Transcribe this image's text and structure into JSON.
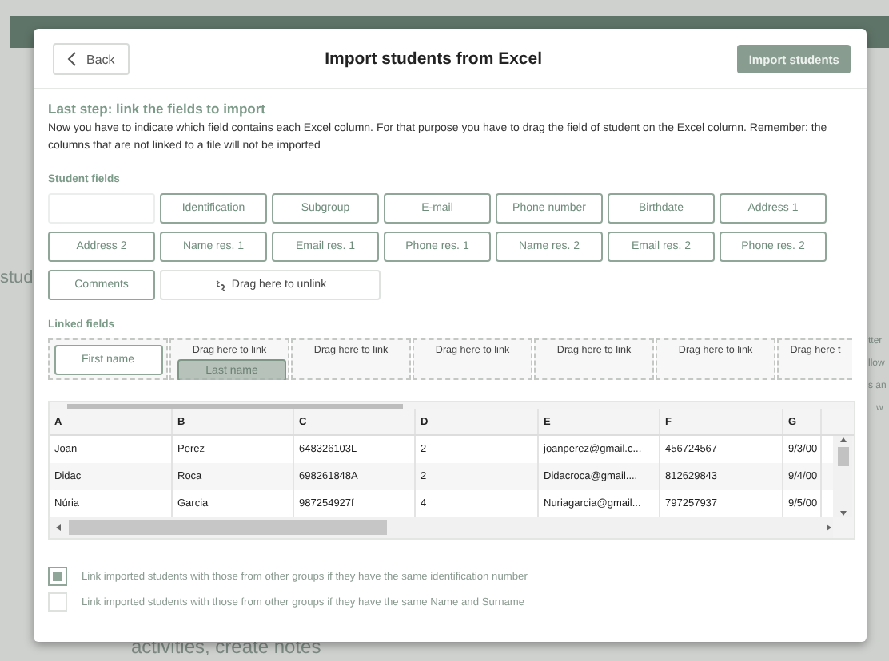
{
  "background": {
    "texts": [
      "stud",
      "tter",
      "llow",
      "s an",
      "w",
      "activities, create notes"
    ]
  },
  "dialog": {
    "back_label": "Back",
    "title": "Import students from Excel",
    "import_label": "Import students"
  },
  "step_title": "Last step: link the fields to import",
  "description": "Now you have to indicate which field contains each Excel column. For that purpose you have to drag the field of student on the Excel column. Remember: the columns that are not linked to a file will not be imported",
  "student_fields": {
    "title": "Student fields",
    "items": [
      {
        "kind": "empty"
      },
      {
        "kind": "chip",
        "label": "Identification"
      },
      {
        "kind": "chip",
        "label": "Subgroup"
      },
      {
        "kind": "chip",
        "label": "E-mail"
      },
      {
        "kind": "chip",
        "label": "Phone number"
      },
      {
        "kind": "chip",
        "label": "Birthdate"
      },
      {
        "kind": "chip",
        "label": "Address 1"
      },
      {
        "kind": "chip",
        "label": "Address 2"
      },
      {
        "kind": "chip",
        "label": "Name res. 1"
      },
      {
        "kind": "chip",
        "label": "Email res. 1"
      },
      {
        "kind": "chip",
        "label": "Phone res. 1"
      },
      {
        "kind": "chip",
        "label": "Name res. 2"
      },
      {
        "kind": "chip",
        "label": "Email res. 2"
      },
      {
        "kind": "chip",
        "label": "Phone res. 2"
      },
      {
        "kind": "chip",
        "label": "Comments"
      },
      {
        "kind": "unlink",
        "label": "Drag here to unlink"
      }
    ]
  },
  "linked_fields": {
    "title": "Linked fields",
    "slots": [
      {
        "kind": "linked",
        "label": "First name"
      },
      {
        "kind": "dragging",
        "label": "Drag here to link",
        "chip": "Last name"
      },
      {
        "kind": "empty",
        "label": "Drag here to link"
      },
      {
        "kind": "empty",
        "label": "Drag here to link"
      },
      {
        "kind": "empty",
        "label": "Drag here to link"
      },
      {
        "kind": "empty",
        "label": "Drag here to link"
      },
      {
        "kind": "empty",
        "label": "Drag here t"
      }
    ]
  },
  "table": {
    "columns": [
      "A",
      "B",
      "C",
      "D",
      "E",
      "F",
      "G"
    ],
    "rows": [
      [
        "Joan",
        "Perez",
        "648326103L",
        "2",
        "joanperez@gmail.c...",
        "456724567",
        "9/3/00"
      ],
      [
        "Didac",
        "Roca",
        "698261848A",
        "2",
        "Didacroca@gmail....",
        "812629843",
        "9/4/00"
      ],
      [
        "Núria",
        "Garcia",
        "987254927f",
        "4",
        "Nuriagarcia@gmail...",
        "797257937",
        "9/5/00"
      ]
    ]
  },
  "options": [
    {
      "label": "Link imported students with those from other groups if they have the same identification number",
      "checked": true
    },
    {
      "label": "Link imported students with those from other groups if they have the same Name and Surname",
      "checked": false
    }
  ]
}
